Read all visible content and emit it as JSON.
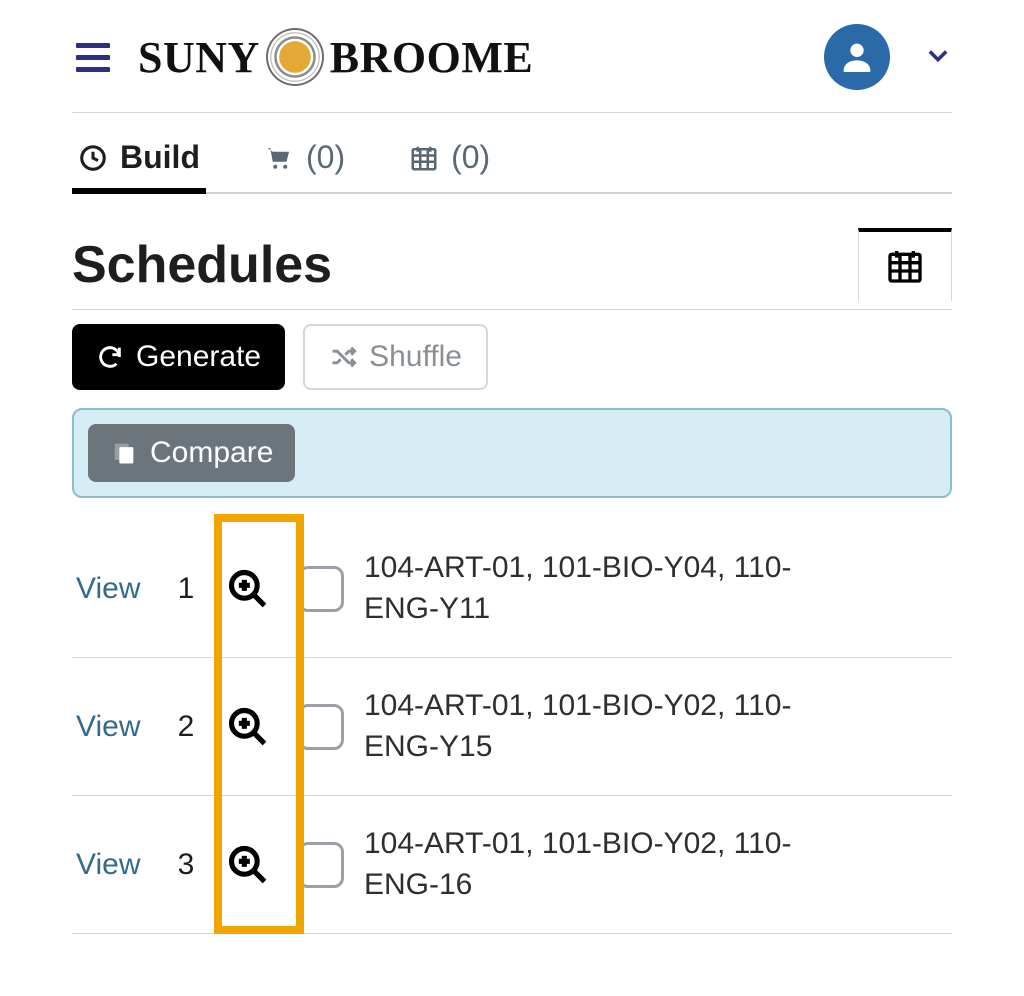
{
  "header": {
    "logo_left": "SUNY",
    "logo_right": "BROOME"
  },
  "tabs": {
    "build_label": "Build",
    "cart_label": "(0)",
    "calendar_label": "(0)"
  },
  "page": {
    "title": "Schedules"
  },
  "buttons": {
    "generate_label": "Generate",
    "shuffle_label": "Shuffle",
    "compare_label": "Compare"
  },
  "schedules": [
    {
      "num": "1",
      "view": "View",
      "courses": "104-ART-01, 101-BIO-Y04, 110-ENG-Y11"
    },
    {
      "num": "2",
      "view": "View",
      "courses": "104-ART-01, 101-BIO-Y02, 110-ENG-Y15"
    },
    {
      "num": "3",
      "view": "View",
      "courses": "104-ART-01, 101-BIO-Y02, 110-ENG-16"
    }
  ]
}
